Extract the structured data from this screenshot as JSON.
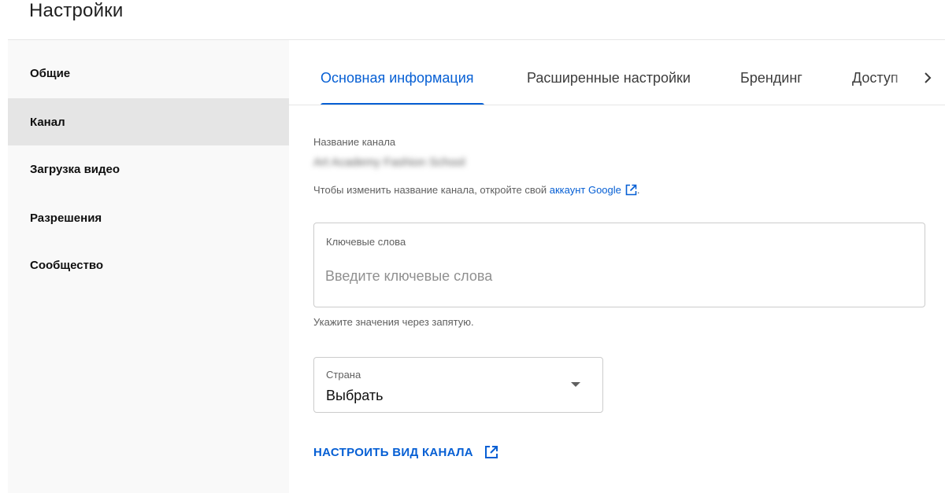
{
  "header": {
    "title": "Настройки"
  },
  "sidebar": {
    "items": [
      {
        "label": "Общие"
      },
      {
        "label": "Канал"
      },
      {
        "label": "Загрузка видео"
      },
      {
        "label": "Разрешения"
      },
      {
        "label": "Сообщество"
      }
    ],
    "active": "Канал"
  },
  "tabs": {
    "items": [
      {
        "label": "Основная информация"
      },
      {
        "label": "Расширенные настройки"
      },
      {
        "label": "Брендинг"
      },
      {
        "label": "Доступ"
      }
    ],
    "active": "Основная информация"
  },
  "channel_name": {
    "caption": "Название канала",
    "value": "Art Academy Fashion School",
    "help_prefix": "Чтобы изменить название канала, откройте свой ",
    "help_link": "аккаунт Google",
    "help_suffix": "."
  },
  "keywords": {
    "label": "Ключевые слова",
    "placeholder": "Введите ключевые слова",
    "value": "",
    "hint": "Укажите значения через запятую."
  },
  "country": {
    "label": "Страна",
    "value": "Выбрать"
  },
  "customize_link": "НАСТРОИТЬ ВИД КАНАЛА",
  "colors": {
    "accent": "#065fd4",
    "sidebar_bg": "#f9f9f9",
    "sidebar_active": "#e5e5e5"
  },
  "icons": {
    "external_link": "open-in-new-icon",
    "tabs_next": "chevron-right-icon",
    "dropdown": "caret-down-icon"
  }
}
